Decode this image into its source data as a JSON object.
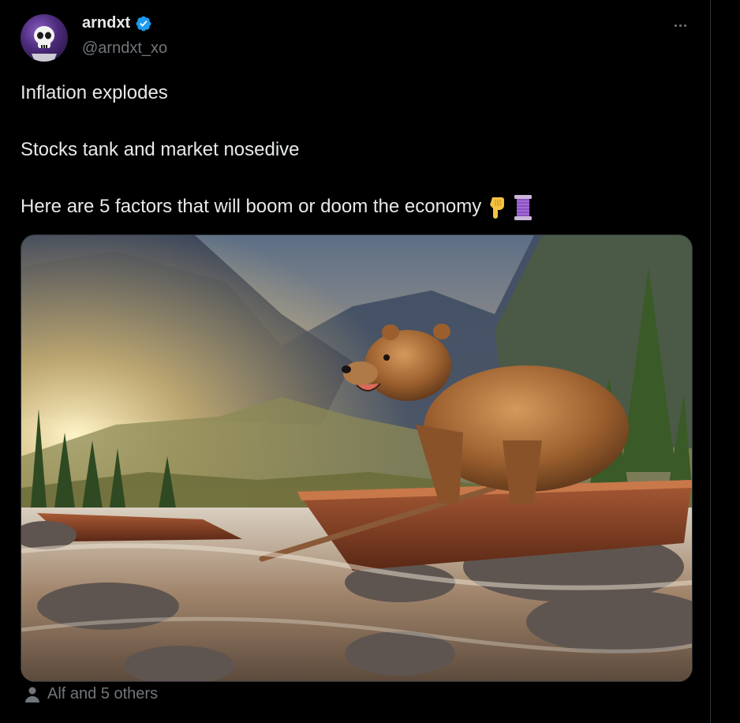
{
  "author": {
    "display_name": "arndxt",
    "handle": "@arndxt_xo",
    "verified": true,
    "avatar_icon": "skull-avatar-icon"
  },
  "tweet": {
    "lines": [
      "Inflation explodes",
      "Stocks tank and market nosedive",
      "Here are 5 factors that will boom or doom the economy"
    ],
    "emojis": [
      "point-down-icon",
      "thread-spool-icon"
    ]
  },
  "media": {
    "kind": "image",
    "subject": "bear-in-boat-river-landscape"
  },
  "social_context": {
    "text": "Alf and 5 others",
    "icon": "person-icon"
  },
  "colors": {
    "background": "#000000",
    "text_primary": "#e7e9ea",
    "text_secondary": "#71767b",
    "verified": "#1d9bf0",
    "divider": "#2f3336"
  }
}
